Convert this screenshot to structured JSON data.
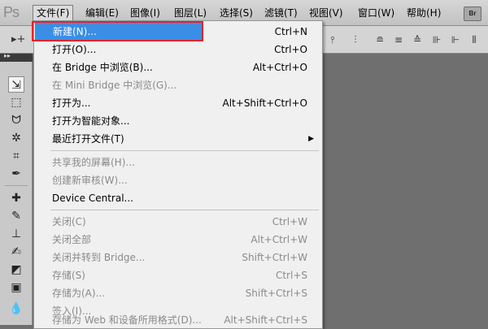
{
  "app": {
    "logo": "Ps"
  },
  "menubar": [
    {
      "label": "文件(F)"
    },
    {
      "label": "编辑(E)"
    },
    {
      "label": "图像(I)"
    },
    {
      "label": "图层(L)"
    },
    {
      "label": "选择(S)"
    },
    {
      "label": "滤镜(T)"
    },
    {
      "label": "视图(V)"
    },
    {
      "label": "窗口(W)"
    },
    {
      "label": "帮助(H)"
    }
  ],
  "bridge_badge": "Br",
  "file_menu": {
    "items": [
      {
        "label": "新建(N)...",
        "shortcut": "Ctrl+N"
      },
      {
        "label": "打开(O)...",
        "shortcut": "Ctrl+O"
      },
      {
        "label": "在 Bridge 中浏览(B)...",
        "shortcut": "Alt+Ctrl+O"
      },
      {
        "label": "在 Mini Bridge 中浏览(G)...",
        "shortcut": ""
      },
      {
        "label": "打开为...",
        "shortcut": "Alt+Shift+Ctrl+O"
      },
      {
        "label": "打开为智能对象...",
        "shortcut": ""
      },
      {
        "label": "最近打开文件(T)",
        "shortcut": ""
      },
      {
        "label": "共享我的屏幕(H)...",
        "shortcut": ""
      },
      {
        "label": "创建新审核(W)...",
        "shortcut": ""
      },
      {
        "label": "Device Central...",
        "shortcut": ""
      },
      {
        "label": "关闭(C)",
        "shortcut": "Ctrl+W"
      },
      {
        "label": "关闭全部",
        "shortcut": "Alt+Ctrl+W"
      },
      {
        "label": "关闭并转到 Bridge...",
        "shortcut": "Shift+Ctrl+W"
      },
      {
        "label": "存储(S)",
        "shortcut": "Ctrl+S"
      },
      {
        "label": "存储为(A)...",
        "shortcut": "Shift+Ctrl+S"
      },
      {
        "label": "签入(I)...",
        "shortcut": ""
      },
      {
        "label": "存储为 Web 和设备所用格式(D)...",
        "shortcut": "Alt+Shift+Ctrl+S"
      }
    ]
  },
  "colors": {
    "highlight": "#3a8ee6",
    "annotation": "#e8232a",
    "canvas_bg": "#6f6f6f"
  }
}
